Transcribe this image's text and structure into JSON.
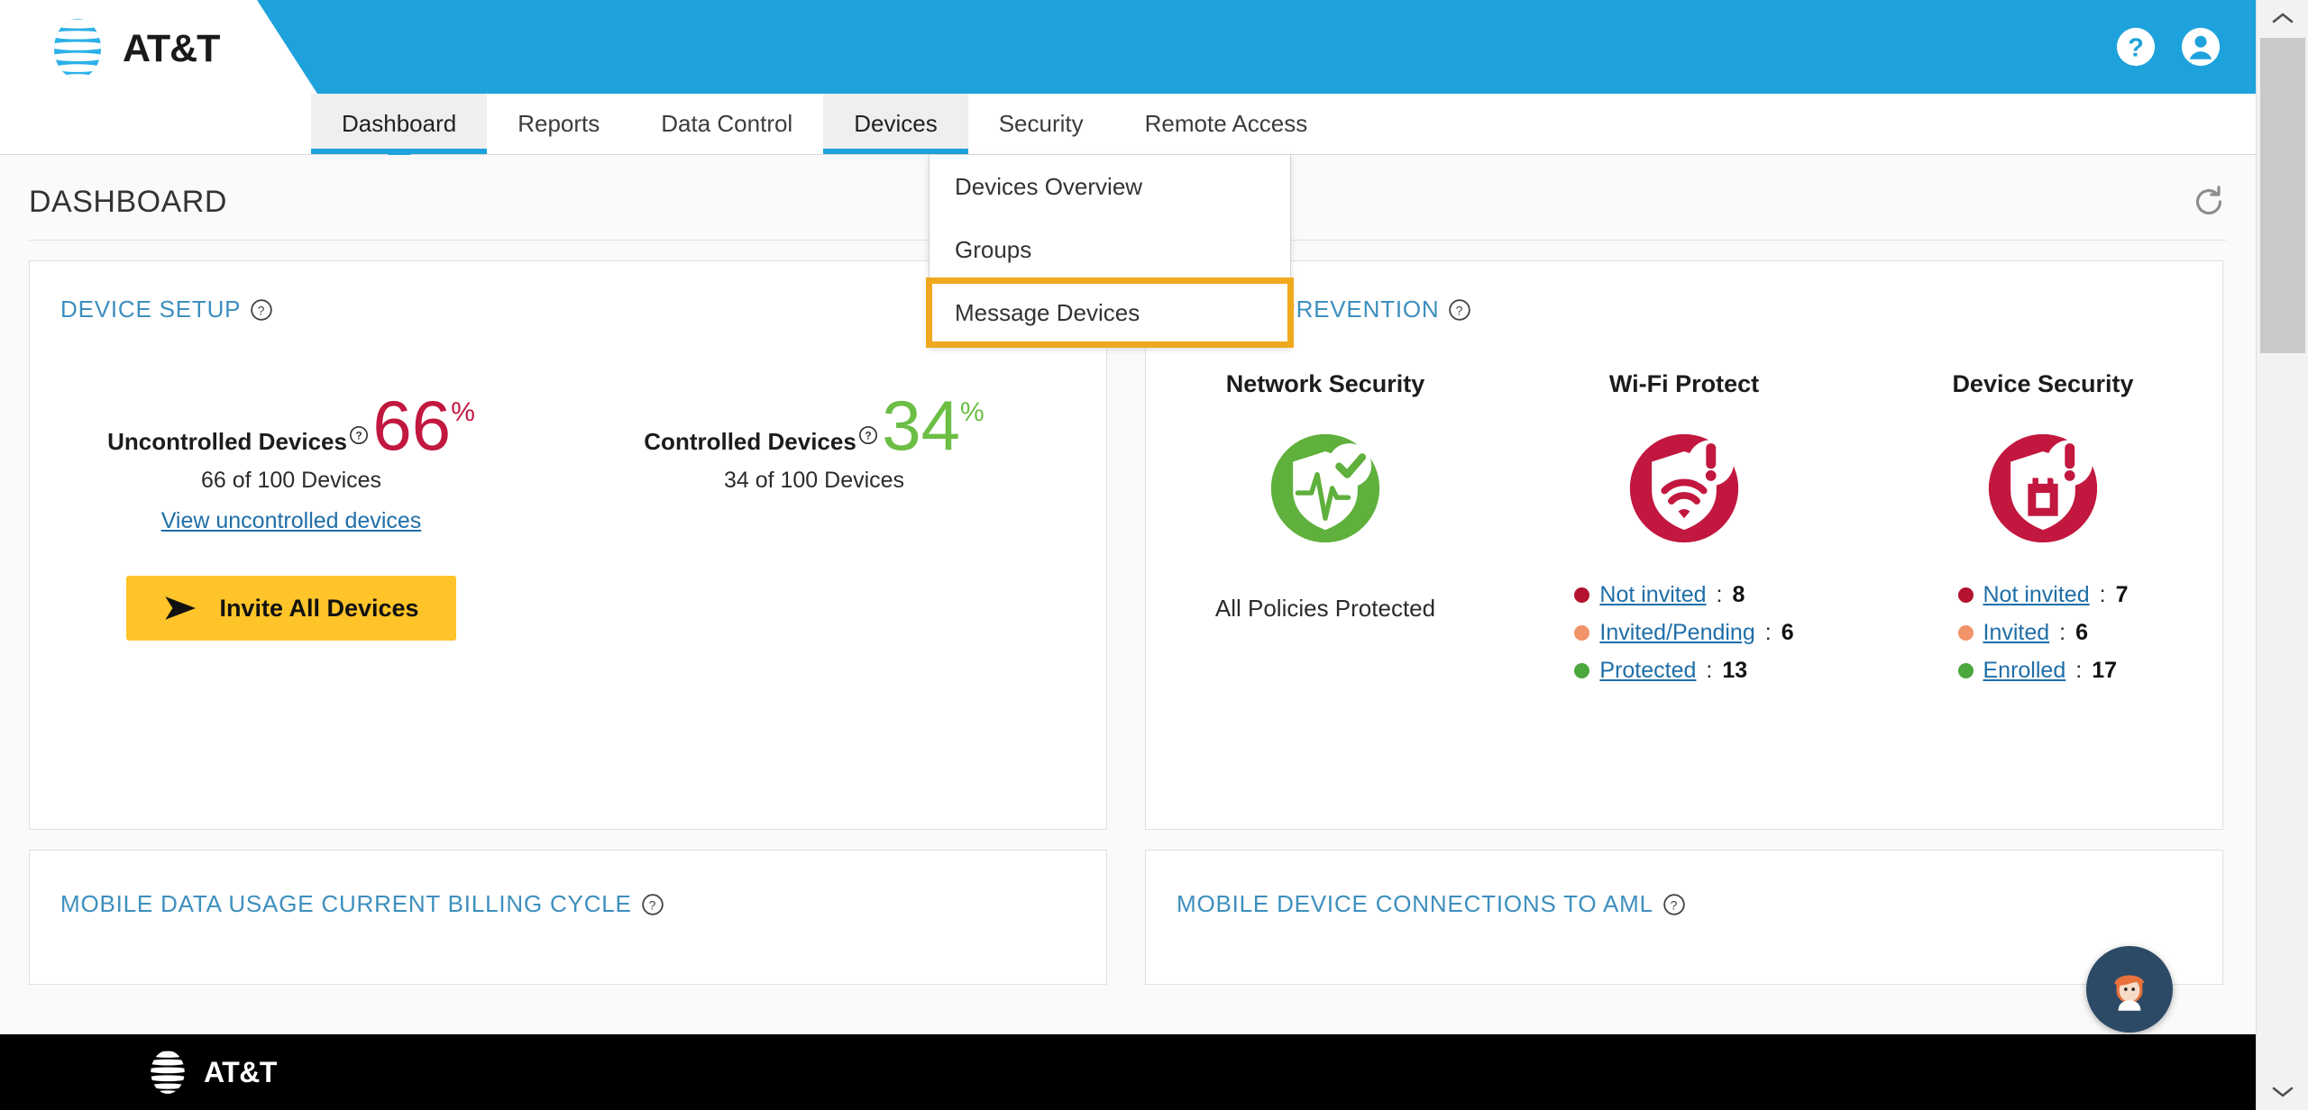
{
  "brand": {
    "name": "AT&T",
    "logo_icon": "att-globe-icon"
  },
  "header": {
    "help_icon": "help-circle-icon",
    "account_icon": "account-circle-icon",
    "background_color": "#1ea2db"
  },
  "nav": {
    "items": [
      {
        "label": "Dashboard",
        "active": true,
        "has_caret": true
      },
      {
        "label": "Reports",
        "active": false,
        "has_caret": false
      },
      {
        "label": "Data Control",
        "active": false,
        "has_caret": false
      },
      {
        "label": "Devices",
        "active": true,
        "has_caret": false
      },
      {
        "label": "Security",
        "active": false,
        "has_caret": false
      },
      {
        "label": "Remote Access",
        "active": false,
        "has_caret": false
      }
    ]
  },
  "dropdown": {
    "parent": "Devices",
    "items": [
      {
        "label": "Devices Overview",
        "highlighted": false
      },
      {
        "label": "Groups",
        "highlighted": false
      },
      {
        "label": "Message Devices",
        "highlighted": true
      }
    ],
    "highlight_color": "#f0a81e"
  },
  "page": {
    "title": "DASHBOARD",
    "refresh_icon": "refresh-icon"
  },
  "device_setup": {
    "title": "DEVICE SETUP",
    "help_icon": "question-circle-icon",
    "uncontrolled": {
      "label": "Uncontrolled Devices",
      "percent": "66",
      "percent_symbol": "%",
      "detail": "66 of 100 Devices",
      "color": "#c2173f"
    },
    "controlled": {
      "label": "Controlled Devices",
      "percent": "34",
      "percent_symbol": "%",
      "detail": "34 of 100 Devices",
      "color": "#6cbe45"
    },
    "view_link": "View uncontrolled devices",
    "invite_button": {
      "label": "Invite All Devices",
      "icon": "send-arrow-icon",
      "color": "#ffc429"
    }
  },
  "threat_prevention": {
    "title": "THREAT PREVENTION",
    "help_icon": "question-circle-icon",
    "columns": [
      {
        "name": "Network Security",
        "icon": "shield-pulse-check-icon",
        "icon_color": "#5fb03c",
        "status": "All Policies Protected",
        "legend": []
      },
      {
        "name": "Wi-Fi Protect",
        "icon": "shield-wifi-alert-icon",
        "icon_color": "#c2173f",
        "status": "",
        "legend": [
          {
            "label": "Not invited",
            "value": "8",
            "color": "#b3132f"
          },
          {
            "label": "Invited/Pending",
            "value": "6",
            "color": "#f2936a"
          },
          {
            "label": "Protected",
            "value": "13",
            "color": "#4aa83c"
          }
        ]
      },
      {
        "name": "Device Security",
        "icon": "shield-lock-alert-icon",
        "icon_color": "#c2173f",
        "status": "",
        "legend": [
          {
            "label": "Not invited",
            "value": "7",
            "color": "#b3132f"
          },
          {
            "label": "Invited",
            "value": "6",
            "color": "#f2936a"
          },
          {
            "label": "Enrolled",
            "value": "17",
            "color": "#4aa83c"
          }
        ]
      }
    ]
  },
  "lower_cards": [
    {
      "title": "MOBILE DATA USAGE CURRENT BILLING CYCLE",
      "help_icon": "question-circle-icon"
    },
    {
      "title": "MOBILE DEVICE CONNECTIONS TO AML",
      "help_icon": "question-circle-icon"
    }
  ],
  "assistant": {
    "icon": "assistant-avatar-icon",
    "color": "#2c4a66"
  },
  "footer": {
    "brand": "AT&T",
    "logo_icon": "att-globe-icon",
    "background_color": "#000000"
  },
  "scrollbar": {
    "up_icon": "chevron-up-icon",
    "down_icon": "chevron-down-icon"
  }
}
